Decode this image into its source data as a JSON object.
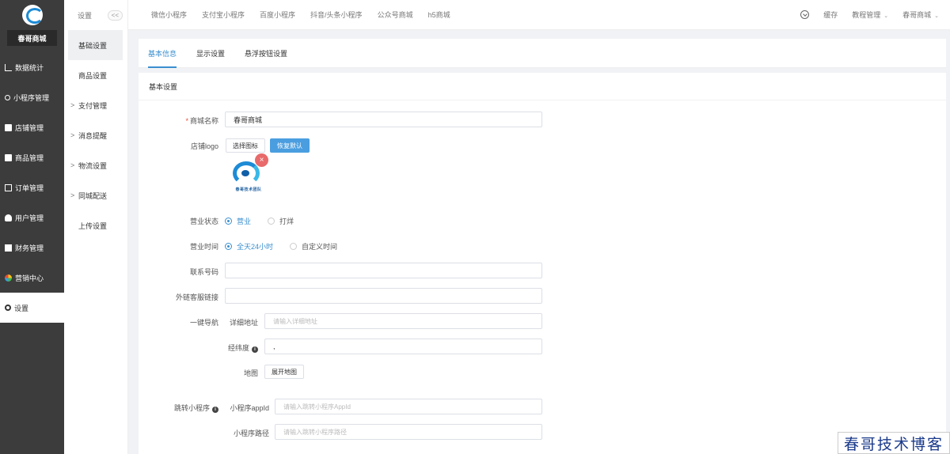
{
  "sidebar": {
    "shop_name": "春哥商城",
    "items": [
      {
        "label": "数据统计",
        "icon": "chart-icon"
      },
      {
        "label": "小程序管理",
        "icon": "link-icon"
      },
      {
        "label": "店铺管理",
        "icon": "shop-icon"
      },
      {
        "label": "商品管理",
        "icon": "goods-icon"
      },
      {
        "label": "订单管理",
        "icon": "order-icon"
      },
      {
        "label": "用户管理",
        "icon": "user-icon"
      },
      {
        "label": "财务管理",
        "icon": "finance-icon"
      },
      {
        "label": "营销中心",
        "icon": "marketing-icon"
      },
      {
        "label": "设置",
        "icon": "gear-icon"
      }
    ]
  },
  "subnav": {
    "title": "设置",
    "collapse": "<<",
    "items": [
      {
        "label": "基础设置",
        "arrow": ""
      },
      {
        "label": "商品设置",
        "arrow": ""
      },
      {
        "label": "支付管理",
        "arrow": ">"
      },
      {
        "label": "消息提醒",
        "arrow": ">"
      },
      {
        "label": "物流设置",
        "arrow": ">"
      },
      {
        "label": "同城配送",
        "arrow": ">"
      },
      {
        "label": "上传设置",
        "arrow": ""
      }
    ]
  },
  "topbar": {
    "tabs": [
      "微信小程序",
      "支付宝小程序",
      "百度小程序",
      "抖音/头条小程序",
      "公众号商城",
      "h5商城"
    ],
    "cache": "缓存",
    "tutorial": "教程管理",
    "account": "春哥商城",
    "dropdown": "⌄"
  },
  "tabs": [
    "基本信息",
    "显示设置",
    "悬浮按钮设置"
  ],
  "section_title": "基本设置",
  "form": {
    "shop_name_label": "商城名称",
    "shop_name_required": "*",
    "shop_name_value": "春哥商城",
    "logo_label": "店铺logo",
    "choose_icon": "选择图标",
    "restore_default": "恢复默认",
    "logo_caption": "春哥技术团队",
    "delete_symbol": "×",
    "status_label": "营业状态",
    "status_options": [
      "营业",
      "打烊"
    ],
    "hours_label": "营业时间",
    "hours_options": [
      "全天24小时",
      "自定义时间"
    ],
    "phone_label": "联系号码",
    "phone_value": "",
    "service_label": "外链客服链接",
    "service_value": "",
    "nav_label": "一键导航",
    "address_label": "详细地址",
    "address_placeholder": "请输入详细地址",
    "latlng_label": "经纬度",
    "latlng_value": ",",
    "map_label": "地图",
    "open_map": "展开地图",
    "jump_label": "跳转小程序",
    "appid_label": "小程序appId",
    "appid_placeholder": "请输入跳转小程序AppId",
    "path_label": "小程序路径",
    "path_placeholder": "请输入跳转小程序路径"
  },
  "watermark": "春哥技术博客"
}
